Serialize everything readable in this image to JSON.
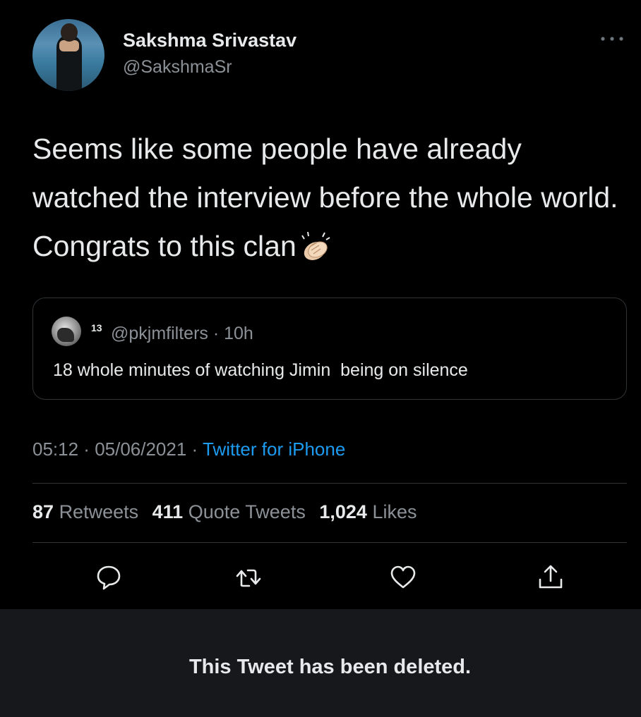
{
  "author": {
    "display_name": "Sakshma Srivastav",
    "handle": "@SakshmaSr",
    "avatar_icon": "profile-photo"
  },
  "more_icon": "ellipsis-icon",
  "tweet": {
    "text": "Seems like some people have already watched the interview before the whole world. Congrats to this clan",
    "emoji_icon": "clapping-hands-icon"
  },
  "quoted_tweet": {
    "name": "13",
    "handle": "@pkjmfilters · 10h",
    "text": "18 whole minutes of watching Jimin  being on silence",
    "avatar_icon": "profile-photo"
  },
  "meta": {
    "time": "05:12",
    "date": "05/06/2021",
    "source": "Twitter for iPhone",
    "separator": " · "
  },
  "stats": {
    "retweets_count": "87",
    "retweets_label": "Retweets",
    "quotes_count": "411",
    "quotes_label": "Quote Tweets",
    "likes_count": "1,024",
    "likes_label": "Likes"
  },
  "actions": {
    "reply_icon": "reply-icon",
    "retweet_icon": "retweet-icon",
    "like_icon": "heart-icon",
    "share_icon": "share-icon"
  },
  "deleted_notice": "This Tweet has been deleted.",
  "colors": {
    "background": "#000000",
    "text": "#e7e9ea",
    "secondary": "#8b9196",
    "link": "#1d9bf0",
    "divider": "#2f3336",
    "notice_background": "#16181c"
  }
}
